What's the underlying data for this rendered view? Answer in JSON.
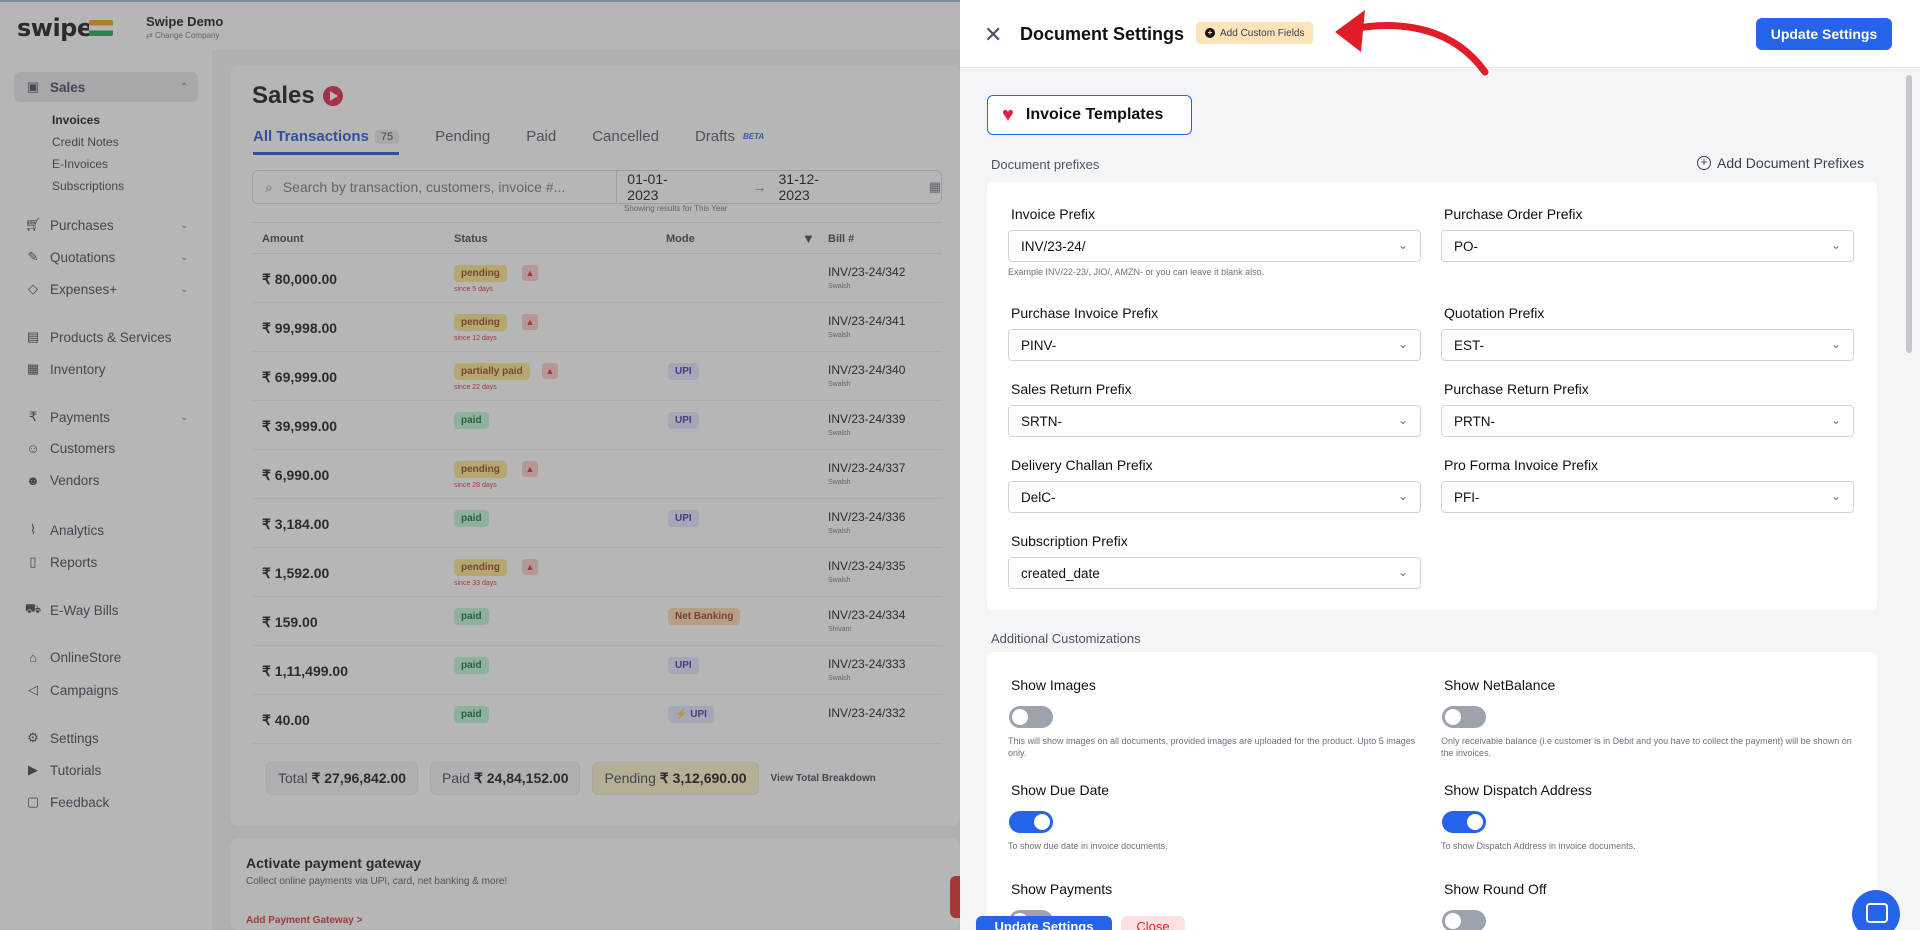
{
  "app": {
    "logo": "swipe",
    "company_name": "Swipe Demo",
    "company_sub": "Change Company"
  },
  "sidebar": {
    "sales": "Sales",
    "subitems": [
      "Invoices",
      "Credit Notes",
      "E-Invoices",
      "Subscriptions"
    ],
    "purchases": "Purchases",
    "quotations": "Quotations",
    "expenses": "Expenses+",
    "products": "Products & Services",
    "inventory": "Inventory",
    "payments": "Payments",
    "customers": "Customers",
    "vendors": "Vendors",
    "analytics": "Analytics",
    "reports": "Reports",
    "eway": "E-Way Bills",
    "onlinestore": "OnlineStore",
    "campaigns": "Campaigns",
    "settings": "Settings",
    "tutorials": "Tutorials",
    "feedback": "Feedback"
  },
  "sales": {
    "title": "Sales",
    "tabs": {
      "all": "All Transactions",
      "all_count": "75",
      "pending": "Pending",
      "paid": "Paid",
      "cancelled": "Cancelled",
      "drafts": "Drafts",
      "beta": "BETA"
    },
    "search_placeholder": "Search by transaction, customers, invoice #...",
    "date_from": "01-01-2023",
    "date_to": "31-12-2023",
    "date_arrow": "→",
    "results_note": "Showing results for This Year",
    "columns": {
      "amount": "Amount",
      "status": "Status",
      "mode": "Mode",
      "bill": "Bill #"
    },
    "rows": [
      {
        "amount": "₹ 80,000.00",
        "status": "pending",
        "since": "since 5 days",
        "mode": "",
        "bill": "INV/23-24/342",
        "bill_sub": "Swalsh"
      },
      {
        "amount": "₹ 99,998.00",
        "status": "pending",
        "since": "since 12 days",
        "mode": "",
        "bill": "INV/23-24/341",
        "bill_sub": "Swalsh"
      },
      {
        "amount": "₹ 69,999.00",
        "status": "partially paid",
        "since": "since 22 days",
        "mode": "UPI",
        "bill": "INV/23-24/340",
        "bill_sub": "Swalsh"
      },
      {
        "amount": "₹ 39,999.00",
        "status": "paid",
        "since": "",
        "mode": "UPI",
        "bill": "INV/23-24/339",
        "bill_sub": "Swalsh"
      },
      {
        "amount": "₹ 6,990.00",
        "status": "pending",
        "since": "since 28 days",
        "mode": "",
        "bill": "INV/23-24/337",
        "bill_sub": "Swalsh"
      },
      {
        "amount": "₹ 3,184.00",
        "status": "paid",
        "since": "",
        "mode": "UPI",
        "bill": "INV/23-24/336",
        "bill_sub": "Swalsh"
      },
      {
        "amount": "₹ 1,592.00",
        "status": "pending",
        "since": "since 33 days",
        "mode": "",
        "bill": "INV/23-24/335",
        "bill_sub": "Swalsh"
      },
      {
        "amount": "₹ 159.00",
        "status": "paid",
        "since": "",
        "mode": "Net Banking",
        "bill": "INV/23-24/334",
        "bill_sub": "Shivani"
      },
      {
        "amount": "₹ 1,11,499.00",
        "status": "paid",
        "since": "",
        "mode": "UPI",
        "bill": "INV/23-24/333",
        "bill_sub": "Swalsh"
      },
      {
        "amount": "₹ 40.00",
        "status": "paid",
        "since": "",
        "mode": "⚡ UPI",
        "bill": "INV/23-24/332",
        "bill_sub": ""
      }
    ],
    "totals": {
      "total_label": "Total",
      "total": "₹ 27,96,842.00",
      "paid_label": "Paid",
      "paid": "₹ 24,84,152.00",
      "pending_label": "Pending",
      "pending": "₹ 3,12,690.00",
      "breakdown": "View Total Breakdown"
    }
  },
  "gateway": {
    "title": "Activate payment gateway",
    "subtitle": "Collect online payments via UPI, card, net banking & more!",
    "link": "Add Payment Gateway >"
  },
  "panel": {
    "title": "Document Settings",
    "add_custom_fields": "Add Custom Fields",
    "update_button": "Update Settings",
    "close_button": "Close",
    "invoice_templates": "Invoice Templates",
    "prefixes_label": "Document prefixes",
    "add_prefixes": "Add Document Prefixes",
    "fields": [
      {
        "label": "Invoice Prefix",
        "value": "INV/23-24/"
      },
      {
        "label": "Purchase Order Prefix",
        "value": "PO-"
      },
      {
        "label": "Purchase Invoice Prefix",
        "value": "PINV-"
      },
      {
        "label": "Quotation Prefix",
        "value": "EST-"
      },
      {
        "label": "Sales Return Prefix",
        "value": "SRTN-"
      },
      {
        "label": "Purchase Return Prefix",
        "value": "PRTN-"
      },
      {
        "label": "Delivery Challan Prefix",
        "value": "DelC-"
      },
      {
        "label": "Pro Forma Invoice Prefix",
        "value": "PFI-"
      },
      {
        "label": "Subscription Prefix",
        "value": "created_date"
      }
    ],
    "invoice_hint": "Example INV/22-23/, JIO/, AMZN- or you can leave it blank also.",
    "additional_label": "Additional Customizations",
    "toggles": [
      {
        "label": "Show Images",
        "on": false,
        "hint": "This will show images on all documents, provided images are uploaded for the product. Upto 5 images only."
      },
      {
        "label": "Show NetBalance",
        "on": false,
        "hint": "Only receivable balance (i.e customer is in Debit and you have to collect the payment) will be shown on the invoices."
      },
      {
        "label": "Show Due Date",
        "on": true,
        "hint": "To show due date in invoice documents."
      },
      {
        "label": "Show Dispatch Address",
        "on": true,
        "hint": "To show Dispatch Address in invoice documents."
      },
      {
        "label": "Show Payments",
        "on": false,
        "hint": ""
      },
      {
        "label": "Show Round Off",
        "on": false,
        "hint": ""
      }
    ]
  },
  "colors": {
    "accent": "#2563eb",
    "annotation_arrow": "#e11d2a"
  }
}
